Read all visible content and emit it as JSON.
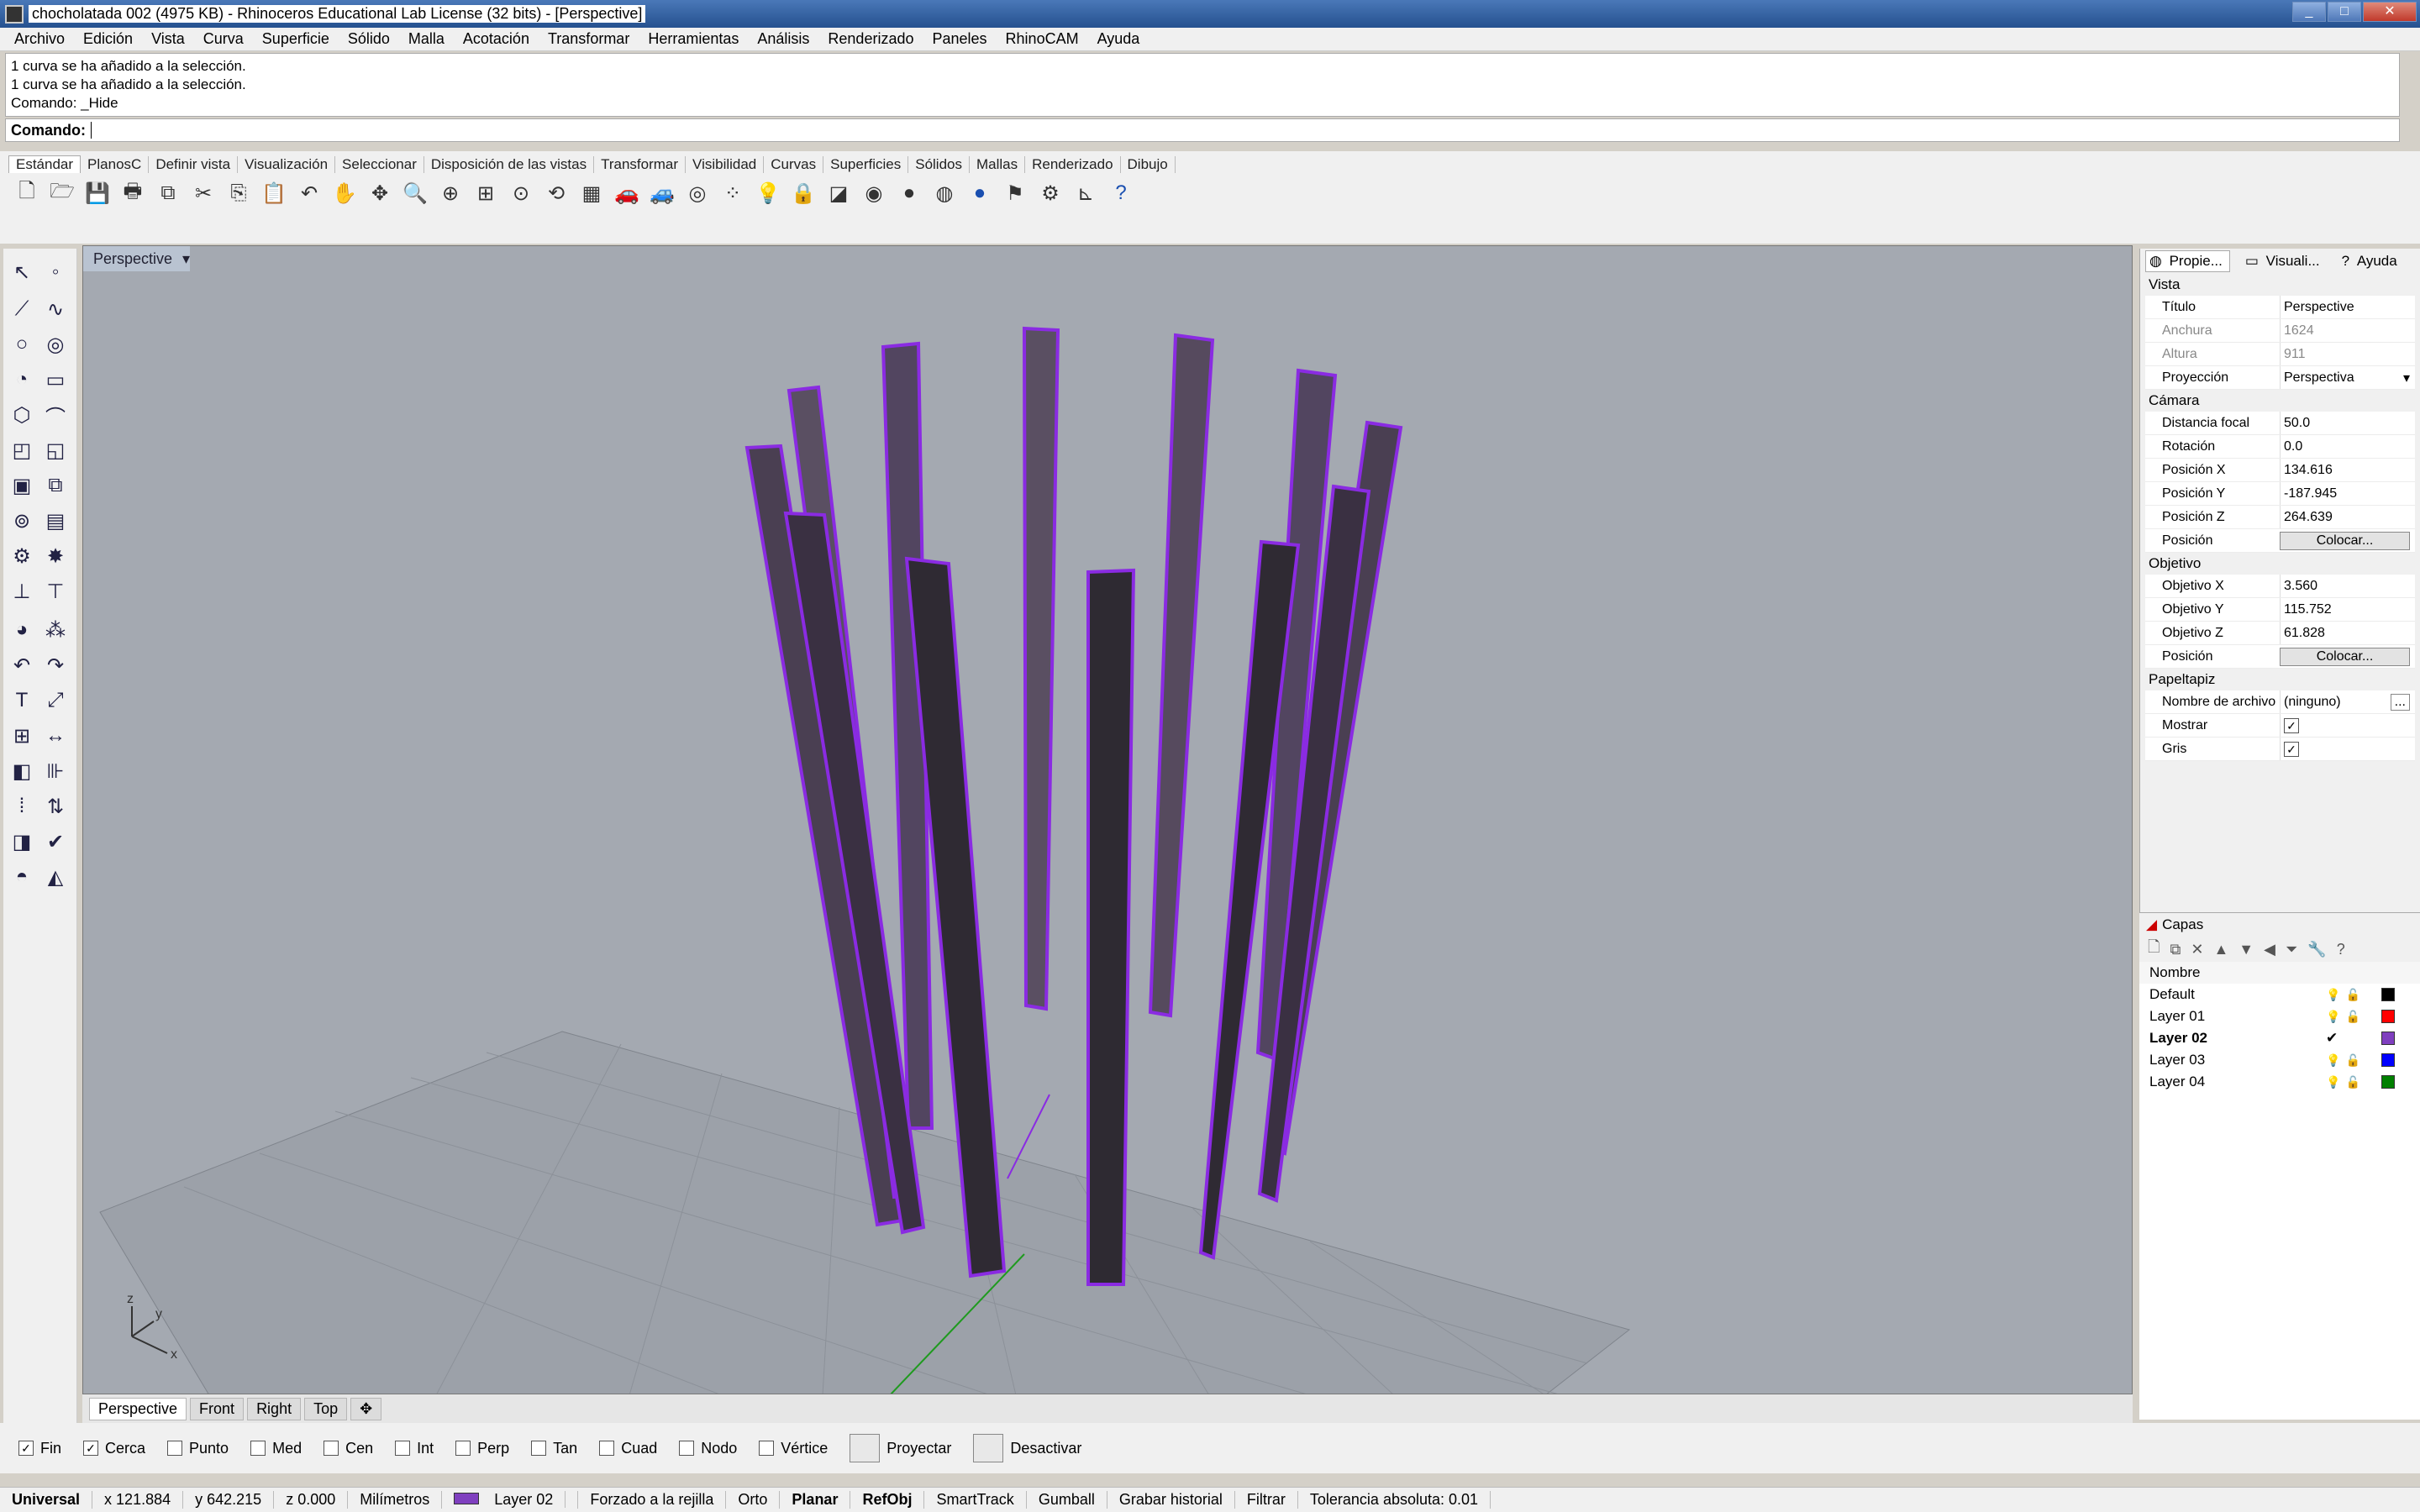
{
  "window": {
    "title": "chocholatada 002 (4975 KB) - Rhinoceros Educational Lab License (32 bits) - [Perspective]"
  },
  "menu": [
    "Archivo",
    "Edición",
    "Vista",
    "Curva",
    "Superficie",
    "Sólido",
    "Malla",
    "Acotación",
    "Transformar",
    "Herramientas",
    "Análisis",
    "Renderizado",
    "Paneles",
    "RhinoCAM",
    "Ayuda"
  ],
  "history": [
    "1 curva se ha añadido a la selección.",
    "1 curva se ha añadido a la selección.",
    "Comando: _Hide"
  ],
  "command": {
    "label": "Comando:",
    "value": ""
  },
  "toolbar_tabs": [
    "Estándar",
    "PlanosC",
    "Definir vista",
    "Visualización",
    "Seleccionar",
    "Disposición de las vistas",
    "Transformar",
    "Visibilidad",
    "Curvas",
    "Superficies",
    "Sólidos",
    "Mallas",
    "Renderizado",
    "Dibujo"
  ],
  "viewport": {
    "title": "Perspective"
  },
  "view_tabs": [
    "Perspective",
    "Front",
    "Right",
    "Top"
  ],
  "props": {
    "tabs": [
      "Propie...",
      "Visuali...",
      "Ayuda"
    ],
    "vista_label": "Vista",
    "titulo": {
      "k": "Título",
      "v": "Perspective"
    },
    "anchura": {
      "k": "Anchura",
      "v": "1624"
    },
    "altura": {
      "k": "Altura",
      "v": "911"
    },
    "proyeccion": {
      "k": "Proyección",
      "v": "Perspectiva"
    },
    "camara_label": "Cámara",
    "focal": {
      "k": "Distancia focal",
      "v": "50.0"
    },
    "rotacion": {
      "k": "Rotación",
      "v": "0.0"
    },
    "px": {
      "k": "Posición X",
      "v": "134.616"
    },
    "py": {
      "k": "Posición Y",
      "v": "-187.945"
    },
    "pz": {
      "k": "Posición Z",
      "v": "264.639"
    },
    "posicion": {
      "k": "Posición",
      "btn": "Colocar..."
    },
    "objetivo_label": "Objetivo",
    "ox": {
      "k": "Objetivo X",
      "v": "3.560"
    },
    "oy": {
      "k": "Objetivo Y",
      "v": "115.752"
    },
    "oz": {
      "k": "Objetivo Z",
      "v": "61.828"
    },
    "posicion2": {
      "k": "Posición",
      "btn": "Colocar..."
    },
    "papel_label": "Papeltapiz",
    "archivo": {
      "k": "Nombre de archivo",
      "v": "(ninguno)"
    },
    "mostrar": {
      "k": "Mostrar",
      "checked": true
    },
    "gris": {
      "k": "Gris",
      "checked": true
    }
  },
  "layers": {
    "title": "Capas",
    "header": "Nombre",
    "items": [
      {
        "name": "Default",
        "color": "#000000",
        "current": false
      },
      {
        "name": "Layer 01",
        "color": "#ff0000",
        "current": false
      },
      {
        "name": "Layer 02",
        "color": "#7f3fbf",
        "current": true
      },
      {
        "name": "Layer 03",
        "color": "#0000ff",
        "current": false
      },
      {
        "name": "Layer 04",
        "color": "#008000",
        "current": false
      }
    ]
  },
  "osnap": [
    {
      "label": "Fin",
      "checked": true
    },
    {
      "label": "Cerca",
      "checked": true
    },
    {
      "label": "Punto",
      "checked": false
    },
    {
      "label": "Med",
      "checked": false
    },
    {
      "label": "Cen",
      "checked": false
    },
    {
      "label": "Int",
      "checked": false
    },
    {
      "label": "Perp",
      "checked": false
    },
    {
      "label": "Tan",
      "checked": false
    },
    {
      "label": "Cuad",
      "checked": false
    },
    {
      "label": "Nodo",
      "checked": false
    },
    {
      "label": "Vértice",
      "checked": false
    }
  ],
  "osnap_buttons": [
    "Proyectar",
    "Desactivar"
  ],
  "status": {
    "plane": "Universal",
    "x": "x 121.884",
    "y": "y 642.215",
    "z": "z 0.000",
    "units": "Milímetros",
    "layer": "Layer 02",
    "grid": "Forzado a la rejilla",
    "ortho": "Orto",
    "planar": "Planar",
    "refobj": "RefObj",
    "smarttrack": "SmartTrack",
    "gumball": "Gumball",
    "history": "Grabar historial",
    "filter": "Filtrar",
    "tol": "Tolerancia absoluta: 0.01"
  },
  "colors": {
    "selection": "#8a2be2",
    "viewport_bg": "#a4a9b1"
  }
}
